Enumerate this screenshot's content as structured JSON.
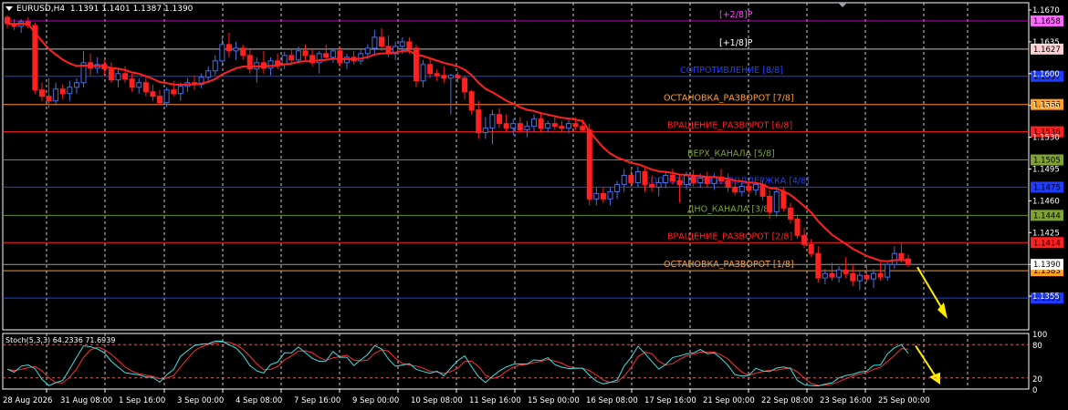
{
  "header": {
    "symbol": "EURUSD,H4",
    "ohlc": "1.1391 1.1401 1.1387 1.1390"
  },
  "stoch_header": "Stoch(5,3,3) 64.2336 71.6939",
  "chart_data": {
    "type": "candlestick",
    "ylim": [
      1.1318,
      1.1678
    ],
    "price_ticks": [
      "1.1670",
      "1.1635",
      "1.1600",
      "1.1565",
      "1.1530",
      "1.1495",
      "1.1460",
      "1.1425",
      "1.1390",
      "1.1355"
    ],
    "current_price": "1.1390",
    "murrey_levels": [
      {
        "label": "[+2/8]P",
        "value": 1.1658,
        "tag": "1.1658",
        "line_color": "#c000c0",
        "text_color": "#ff44ff",
        "tag_bg": "#ff66ff",
        "tag_fg": "#000000"
      },
      {
        "label": "[+1/8]P",
        "value": 1.1627,
        "tag": "1.1627",
        "line_color": "#c0c0c0",
        "text_color": "#ffffff",
        "tag_bg": "#ffd0d0",
        "tag_fg": "#000000"
      },
      {
        "label": "СОПРОТИВЛЕНИЕ [8/8]",
        "value": 1.1597,
        "tag": "1.1597",
        "line_color": "#2040ff",
        "text_color": "#2040ff",
        "tag_bg": "#1e3cff",
        "tag_fg": "#000000"
      },
      {
        "label": "ОСТАНОВКА_РАЗВОРОТ [7/8]",
        "value": 1.1566,
        "tag": "1.1566",
        "line_color": "#ff9020",
        "text_color": "#ffa030",
        "tag_bg": "#ffa020",
        "tag_fg": "#000000"
      },
      {
        "label": "ВРАЩЕНИЕ_РАЗВОРОТ [6/8]",
        "value": 1.1536,
        "tag": "1.1536",
        "line_color": "#ff2020",
        "text_color": "#ff2020",
        "tag_bg": "#ff2020",
        "tag_fg": "#000000"
      },
      {
        "label": "ВЕРХ_КАНАЛА [5/8]",
        "value": 1.1505,
        "tag": "1.1505",
        "line_color": "#6b8e23",
        "text_color": "#7ea332",
        "tag_bg": "#7ea332",
        "tag_fg": "#000000"
      },
      {
        "label": "СОПРОТИВЛЕНИЕ/ПОДДЕРЖКА [4/8]",
        "value": 1.1475,
        "tag": "1.1475",
        "line_color": "#2040ff",
        "text_color": "#2040ff",
        "tag_bg": "#1e3cff",
        "tag_fg": "#000000"
      },
      {
        "label": "ДНО_КАНАЛА [3/8]",
        "value": 1.1444,
        "tag": "1.1444",
        "line_color": "#6b8e23",
        "text_color": "#7ea332",
        "tag_bg": "#7ea332",
        "tag_fg": "#000000"
      },
      {
        "label": "ВРАЩЕНИЕ_РАЗВОРОТ [2/8]",
        "value": 1.1414,
        "tag": "1.1414",
        "line_color": "#ff2020",
        "text_color": "#ff2020",
        "tag_bg": "#ff2020",
        "tag_fg": "#000000"
      },
      {
        "label": "ОСТАНОВКА_РАЗВОРОТ [1/8]",
        "value": 1.1383,
        "tag": "1.1383",
        "line_color": "#ff9020",
        "text_color": "#ffa030",
        "tag_bg": "#ffa020",
        "tag_fg": "#000000"
      },
      {
        "label": "",
        "value": 1.1353,
        "tag": "1.1353",
        "line_color": "#2040ff",
        "text_color": "#2040ff",
        "tag_bg": "#1e3cff",
        "tag_fg": "#000000"
      }
    ],
    "x_labels": [
      "28 Aug 2026",
      "31 Aug 08:00",
      "1 Sep 16:00",
      "3 Sep 00:00",
      "4 Sep 08:00",
      "7 Sep 16:00",
      "9 Sep 00:00",
      "10 Sep 08:00",
      "11 Sep 16:00",
      "15 Sep 00:00",
      "16 Sep 08:00",
      "17 Sep 16:00",
      "21 Sep 00:00",
      "22 Sep 08:00",
      "23 Sep 16:00",
      "25 Sep 00:00"
    ],
    "candles": [
      {
        "o": 1.1662,
        "h": 1.1664,
        "l": 1.165,
        "c": 1.1655
      },
      {
        "o": 1.1655,
        "h": 1.166,
        "l": 1.1648,
        "c": 1.1652
      },
      {
        "o": 1.1652,
        "h": 1.166,
        "l": 1.1645,
        "c": 1.1657
      },
      {
        "o": 1.1657,
        "h": 1.1662,
        "l": 1.165,
        "c": 1.1653
      },
      {
        "o": 1.1653,
        "h": 1.1656,
        "l": 1.1578,
        "c": 1.1582
      },
      {
        "o": 1.1582,
        "h": 1.159,
        "l": 1.157,
        "c": 1.1575
      },
      {
        "o": 1.1575,
        "h": 1.1595,
        "l": 1.1562,
        "c": 1.157
      },
      {
        "o": 1.157,
        "h": 1.159,
        "l": 1.1565,
        "c": 1.1583
      },
      {
        "o": 1.1583,
        "h": 1.1588,
        "l": 1.1572,
        "c": 1.1578
      },
      {
        "o": 1.1578,
        "h": 1.1592,
        "l": 1.157,
        "c": 1.1585
      },
      {
        "o": 1.1585,
        "h": 1.1595,
        "l": 1.1578,
        "c": 1.159
      },
      {
        "o": 1.159,
        "h": 1.1625,
        "l": 1.1585,
        "c": 1.1612
      },
      {
        "o": 1.1612,
        "h": 1.1622,
        "l": 1.1598,
        "c": 1.1606
      },
      {
        "o": 1.1606,
        "h": 1.1618,
        "l": 1.16,
        "c": 1.161
      },
      {
        "o": 1.161,
        "h": 1.1615,
        "l": 1.1598,
        "c": 1.1605
      },
      {
        "o": 1.1605,
        "h": 1.1612,
        "l": 1.159,
        "c": 1.1593
      },
      {
        "o": 1.1593,
        "h": 1.1605,
        "l": 1.1585,
        "c": 1.16
      },
      {
        "o": 1.16,
        "h": 1.1608,
        "l": 1.159,
        "c": 1.1594
      },
      {
        "o": 1.1594,
        "h": 1.16,
        "l": 1.158,
        "c": 1.1585
      },
      {
        "o": 1.1585,
        "h": 1.1595,
        "l": 1.1578,
        "c": 1.159
      },
      {
        "o": 1.159,
        "h": 1.1598,
        "l": 1.1575,
        "c": 1.158
      },
      {
        "o": 1.158,
        "h": 1.1588,
        "l": 1.157,
        "c": 1.1575
      },
      {
        "o": 1.1575,
        "h": 1.1582,
        "l": 1.1565,
        "c": 1.1568
      },
      {
        "o": 1.1568,
        "h": 1.1585,
        "l": 1.1563,
        "c": 1.1582
      },
      {
        "o": 1.1582,
        "h": 1.1592,
        "l": 1.1575,
        "c": 1.1578
      },
      {
        "o": 1.1578,
        "h": 1.159,
        "l": 1.157,
        "c": 1.1586
      },
      {
        "o": 1.1586,
        "h": 1.1595,
        "l": 1.158,
        "c": 1.159
      },
      {
        "o": 1.159,
        "h": 1.1598,
        "l": 1.1582,
        "c": 1.1588
      },
      {
        "o": 1.1588,
        "h": 1.16,
        "l": 1.1584,
        "c": 1.1596
      },
      {
        "o": 1.1596,
        "h": 1.1608,
        "l": 1.159,
        "c": 1.1603
      },
      {
        "o": 1.1603,
        "h": 1.162,
        "l": 1.1598,
        "c": 1.1614
      },
      {
        "o": 1.1614,
        "h": 1.164,
        "l": 1.1608,
        "c": 1.1632
      },
      {
        "o": 1.1632,
        "h": 1.1645,
        "l": 1.1618,
        "c": 1.1625
      },
      {
        "o": 1.1625,
        "h": 1.1635,
        "l": 1.1615,
        "c": 1.1628
      },
      {
        "o": 1.1628,
        "h": 1.1632,
        "l": 1.1615,
        "c": 1.162
      },
      {
        "o": 1.162,
        "h": 1.1628,
        "l": 1.16,
        "c": 1.1605
      },
      {
        "o": 1.1605,
        "h": 1.1618,
        "l": 1.159,
        "c": 1.1612
      },
      {
        "o": 1.1612,
        "h": 1.1625,
        "l": 1.16,
        "c": 1.1606
      },
      {
        "o": 1.1606,
        "h": 1.1618,
        "l": 1.1598,
        "c": 1.1614
      },
      {
        "o": 1.1614,
        "h": 1.1622,
        "l": 1.1605,
        "c": 1.161
      },
      {
        "o": 1.161,
        "h": 1.1624,
        "l": 1.1605,
        "c": 1.162
      },
      {
        "o": 1.162,
        "h": 1.1628,
        "l": 1.161,
        "c": 1.1615
      },
      {
        "o": 1.1615,
        "h": 1.163,
        "l": 1.1612,
        "c": 1.1625
      },
      {
        "o": 1.1625,
        "h": 1.1632,
        "l": 1.1615,
        "c": 1.162
      },
      {
        "o": 1.162,
        "h": 1.1628,
        "l": 1.1608,
        "c": 1.1612
      },
      {
        "o": 1.1612,
        "h": 1.1625,
        "l": 1.16,
        "c": 1.1622
      },
      {
        "o": 1.1622,
        "h": 1.1632,
        "l": 1.1615,
        "c": 1.1618
      },
      {
        "o": 1.1618,
        "h": 1.1628,
        "l": 1.1612,
        "c": 1.1625
      },
      {
        "o": 1.1625,
        "h": 1.163,
        "l": 1.1608,
        "c": 1.1612
      },
      {
        "o": 1.1612,
        "h": 1.1622,
        "l": 1.1605,
        "c": 1.1618
      },
      {
        "o": 1.1618,
        "h": 1.1625,
        "l": 1.161,
        "c": 1.1614
      },
      {
        "o": 1.1614,
        "h": 1.1626,
        "l": 1.161,
        "c": 1.1622
      },
      {
        "o": 1.1622,
        "h": 1.1632,
        "l": 1.1616,
        "c": 1.1628
      },
      {
        "o": 1.1628,
        "h": 1.1648,
        "l": 1.1622,
        "c": 1.164
      },
      {
        "o": 1.164,
        "h": 1.165,
        "l": 1.1625,
        "c": 1.163
      },
      {
        "o": 1.163,
        "h": 1.1642,
        "l": 1.1618,
        "c": 1.1622
      },
      {
        "o": 1.1622,
        "h": 1.1635,
        "l": 1.1615,
        "c": 1.163
      },
      {
        "o": 1.163,
        "h": 1.164,
        "l": 1.1622,
        "c": 1.1635
      },
      {
        "o": 1.1635,
        "h": 1.164,
        "l": 1.1622,
        "c": 1.1628
      },
      {
        "o": 1.1628,
        "h": 1.1632,
        "l": 1.1585,
        "c": 1.1592
      },
      {
        "o": 1.1592,
        "h": 1.1615,
        "l": 1.1585,
        "c": 1.161
      },
      {
        "o": 1.161,
        "h": 1.1618,
        "l": 1.1595,
        "c": 1.16
      },
      {
        "o": 1.16,
        "h": 1.1605,
        "l": 1.1592,
        "c": 1.1598
      },
      {
        "o": 1.1598,
        "h": 1.1608,
        "l": 1.159,
        "c": 1.1595
      },
      {
        "o": 1.1595,
        "h": 1.16,
        "l": 1.1555,
        "c": 1.1598
      },
      {
        "o": 1.1598,
        "h": 1.1602,
        "l": 1.159,
        "c": 1.1595
      },
      {
        "o": 1.1595,
        "h": 1.1598,
        "l": 1.1572,
        "c": 1.158
      },
      {
        "o": 1.158,
        "h": 1.1582,
        "l": 1.1555,
        "c": 1.156
      },
      {
        "o": 1.156,
        "h": 1.157,
        "l": 1.1528,
        "c": 1.1535
      },
      {
        "o": 1.1535,
        "h": 1.1552,
        "l": 1.1528,
        "c": 1.154
      },
      {
        "o": 1.154,
        "h": 1.156,
        "l": 1.1522,
        "c": 1.1555
      },
      {
        "o": 1.1555,
        "h": 1.1562,
        "l": 1.154,
        "c": 1.1545
      },
      {
        "o": 1.1545,
        "h": 1.1555,
        "l": 1.1535,
        "c": 1.154
      },
      {
        "o": 1.154,
        "h": 1.155,
        "l": 1.1532,
        "c": 1.1545
      },
      {
        "o": 1.1545,
        "h": 1.1552,
        "l": 1.1535,
        "c": 1.1538
      },
      {
        "o": 1.1538,
        "h": 1.1548,
        "l": 1.153,
        "c": 1.1542
      },
      {
        "o": 1.1542,
        "h": 1.1555,
        "l": 1.1535,
        "c": 1.155
      },
      {
        "o": 1.155,
        "h": 1.1558,
        "l": 1.1535,
        "c": 1.154
      },
      {
        "o": 1.154,
        "h": 1.1548,
        "l": 1.1535,
        "c": 1.1545
      },
      {
        "o": 1.1545,
        "h": 1.1552,
        "l": 1.1538,
        "c": 1.1542
      },
      {
        "o": 1.1542,
        "h": 1.1548,
        "l": 1.1535,
        "c": 1.154
      },
      {
        "o": 1.154,
        "h": 1.155,
        "l": 1.1534,
        "c": 1.1545
      },
      {
        "o": 1.1545,
        "h": 1.1552,
        "l": 1.1538,
        "c": 1.1542
      },
      {
        "o": 1.1542,
        "h": 1.155,
        "l": 1.1535,
        "c": 1.1538
      },
      {
        "o": 1.1538,
        "h": 1.1545,
        "l": 1.1455,
        "c": 1.1462
      },
      {
        "o": 1.1462,
        "h": 1.1475,
        "l": 1.1455,
        "c": 1.1468
      },
      {
        "o": 1.1468,
        "h": 1.1475,
        "l": 1.1458,
        "c": 1.1462
      },
      {
        "o": 1.1462,
        "h": 1.1475,
        "l": 1.1455,
        "c": 1.147
      },
      {
        "o": 1.147,
        "h": 1.1482,
        "l": 1.1462,
        "c": 1.1478
      },
      {
        "o": 1.1478,
        "h": 1.1495,
        "l": 1.147,
        "c": 1.1488
      },
      {
        "o": 1.1488,
        "h": 1.1495,
        "l": 1.1475,
        "c": 1.148
      },
      {
        "o": 1.148,
        "h": 1.1498,
        "l": 1.1475,
        "c": 1.1492
      },
      {
        "o": 1.1492,
        "h": 1.1496,
        "l": 1.147,
        "c": 1.1478
      },
      {
        "o": 1.1478,
        "h": 1.1488,
        "l": 1.147,
        "c": 1.1475
      },
      {
        "o": 1.1475,
        "h": 1.1485,
        "l": 1.1465,
        "c": 1.148
      },
      {
        "o": 1.148,
        "h": 1.1492,
        "l": 1.1474,
        "c": 1.1488
      },
      {
        "o": 1.1488,
        "h": 1.1495,
        "l": 1.1478,
        "c": 1.1482
      },
      {
        "o": 1.1482,
        "h": 1.149,
        "l": 1.1458,
        "c": 1.1478
      },
      {
        "o": 1.1478,
        "h": 1.1492,
        "l": 1.1472,
        "c": 1.1488
      },
      {
        "o": 1.1488,
        "h": 1.1494,
        "l": 1.1476,
        "c": 1.148
      },
      {
        "o": 1.148,
        "h": 1.149,
        "l": 1.1474,
        "c": 1.1485
      },
      {
        "o": 1.1485,
        "h": 1.1492,
        "l": 1.1475,
        "c": 1.1479
      },
      {
        "o": 1.1479,
        "h": 1.149,
        "l": 1.1472,
        "c": 1.1486
      },
      {
        "o": 1.1486,
        "h": 1.1495,
        "l": 1.1478,
        "c": 1.1482
      },
      {
        "o": 1.1482,
        "h": 1.149,
        "l": 1.147,
        "c": 1.1475
      },
      {
        "o": 1.1475,
        "h": 1.1482,
        "l": 1.1466,
        "c": 1.147
      },
      {
        "o": 1.147,
        "h": 1.148,
        "l": 1.1465,
        "c": 1.1476
      },
      {
        "o": 1.1476,
        "h": 1.1482,
        "l": 1.1468,
        "c": 1.1472
      },
      {
        "o": 1.1472,
        "h": 1.148,
        "l": 1.1466,
        "c": 1.1478
      },
      {
        "o": 1.1478,
        "h": 1.1482,
        "l": 1.146,
        "c": 1.1465
      },
      {
        "o": 1.1465,
        "h": 1.1472,
        "l": 1.144,
        "c": 1.1448
      },
      {
        "o": 1.1448,
        "h": 1.1475,
        "l": 1.1442,
        "c": 1.147
      },
      {
        "o": 1.147,
        "h": 1.1475,
        "l": 1.1448,
        "c": 1.1452
      },
      {
        "o": 1.1452,
        "h": 1.1458,
        "l": 1.1435,
        "c": 1.144
      },
      {
        "o": 1.144,
        "h": 1.1445,
        "l": 1.1418,
        "c": 1.1422
      },
      {
        "o": 1.1422,
        "h": 1.143,
        "l": 1.1408,
        "c": 1.1412
      },
      {
        "o": 1.1412,
        "h": 1.1418,
        "l": 1.1398,
        "c": 1.1402
      },
      {
        "o": 1.1402,
        "h": 1.141,
        "l": 1.137,
        "c": 1.1375
      },
      {
        "o": 1.1375,
        "h": 1.1385,
        "l": 1.1368,
        "c": 1.138
      },
      {
        "o": 1.138,
        "h": 1.1392,
        "l": 1.1372,
        "c": 1.1376
      },
      {
        "o": 1.1376,
        "h": 1.1388,
        "l": 1.137,
        "c": 1.1384
      },
      {
        "o": 1.1384,
        "h": 1.1398,
        "l": 1.1375,
        "c": 1.138
      },
      {
        "o": 1.138,
        "h": 1.139,
        "l": 1.1366,
        "c": 1.1372
      },
      {
        "o": 1.1372,
        "h": 1.1382,
        "l": 1.1362,
        "c": 1.1378
      },
      {
        "o": 1.1378,
        "h": 1.139,
        "l": 1.137,
        "c": 1.1374
      },
      {
        "o": 1.1374,
        "h": 1.1385,
        "l": 1.1364,
        "c": 1.138
      },
      {
        "o": 1.138,
        "h": 1.1392,
        "l": 1.1372,
        "c": 1.1376
      },
      {
        "o": 1.1376,
        "h": 1.1392,
        "l": 1.1372,
        "c": 1.139
      },
      {
        "o": 1.139,
        "h": 1.141,
        "l": 1.1385,
        "c": 1.1402
      },
      {
        "o": 1.1402,
        "h": 1.1414,
        "l": 1.1392,
        "c": 1.1396
      },
      {
        "o": 1.1396,
        "h": 1.1401,
        "l": 1.1387,
        "c": 1.139
      }
    ],
    "ma_color": "#ff2020",
    "bull_color": "#4a6fe0",
    "bear_color": "#ff2020",
    "stoch": {
      "params": "Stoch(5,3,3)",
      "main": 64.2336,
      "signal": 71.6939,
      "levels": [
        80,
        20
      ],
      "axis_ticks": [
        "100",
        "80",
        "20",
        "0"
      ],
      "main_color": "#40e0e0",
      "signal_color": "#ff3030"
    },
    "forecast_arrow_color": "#ffee00",
    "grid": "dotted-white"
  }
}
